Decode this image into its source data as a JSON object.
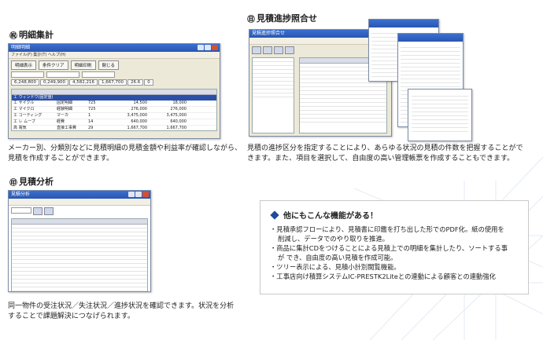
{
  "sections": {
    "detail": {
      "mark": "㊗",
      "title": "明細集計",
      "caption_line1": "メーカー別、分類別などに見積明細の見積金額や利益率が確認しながら、",
      "caption_line2": "見積を作成することができます。",
      "window": {
        "title": "明細明細",
        "menu": "ファイル(F)  集計(T)  ヘルプ(H)",
        "buttons": [
          "明細表示",
          "条件クリア",
          "明細印刷",
          "閉じる"
        ],
        "totals": [
          "6,248,800",
          "0,249,900",
          "4,582,216",
          "1,667,700",
          "26.6",
          "0"
        ],
        "rows": [
          [
            "エ ウィンドウ(固定値)",
            "",
            "",
            "",
            "",
            ""
          ],
          [
            "エ サイクル",
            "固定明細",
            "725",
            "14,500",
            "18,000",
            ""
          ],
          [
            "エ マイクロ",
            "経験明細",
            "725",
            "276,000",
            "276,000",
            ""
          ],
          [
            "エ コーティング",
            "マーカ",
            "1",
            "3,475,000",
            "3,475,000",
            ""
          ],
          [
            "エ レ ムーブ",
            "経費",
            "14",
            "640,000",
            "640,000",
            ""
          ],
          [
            "高 電気",
            "直接工事費",
            "29",
            "1,667,700",
            "1,667,700",
            ""
          ]
        ]
      }
    },
    "progress": {
      "mark": "㊐",
      "title": "見積進捗照合せ",
      "caption_line1": "見積の進捗区分を指定することにより、あらゆる状況の見積の件数を把握することがで",
      "caption_line2": "きます。また、項目を選択して、自由度の高い管理帳票を作成することもできます。",
      "window_title": "見積進捗照合せ"
    },
    "analysis": {
      "mark": "㊞",
      "title": "見積分析",
      "caption_line1": "同一物件の受注状況／失注状況／進捗状況を確認できます。状況を分析",
      "caption_line2": "することで課題解決につなげられます。",
      "window_title": "見積分析"
    }
  },
  "infobox": {
    "heading": "他にもこんな機能がある！",
    "items": [
      {
        "text": "・見積承認フローにより、見積書に印鑑を打ち出した形でのPDF化。紙の使用を",
        "indent": false
      },
      {
        "text": "削減し、データでのやり取りを推進。",
        "indent": true
      },
      {
        "text": "・商品に集計CDをつけることによる見積上での明細を集計したり、ソートする事",
        "indent": false
      },
      {
        "text": "が でき、自由度の高い見積を作成可能。",
        "indent": true
      },
      {
        "text": "・ツリー表示による、見積小計別閲覧機能。",
        "indent": false
      },
      {
        "text": "・工事店向け積算システムIC-PRESTK2Liteとの連動による顧客との連動強化",
        "indent": false
      }
    ]
  }
}
